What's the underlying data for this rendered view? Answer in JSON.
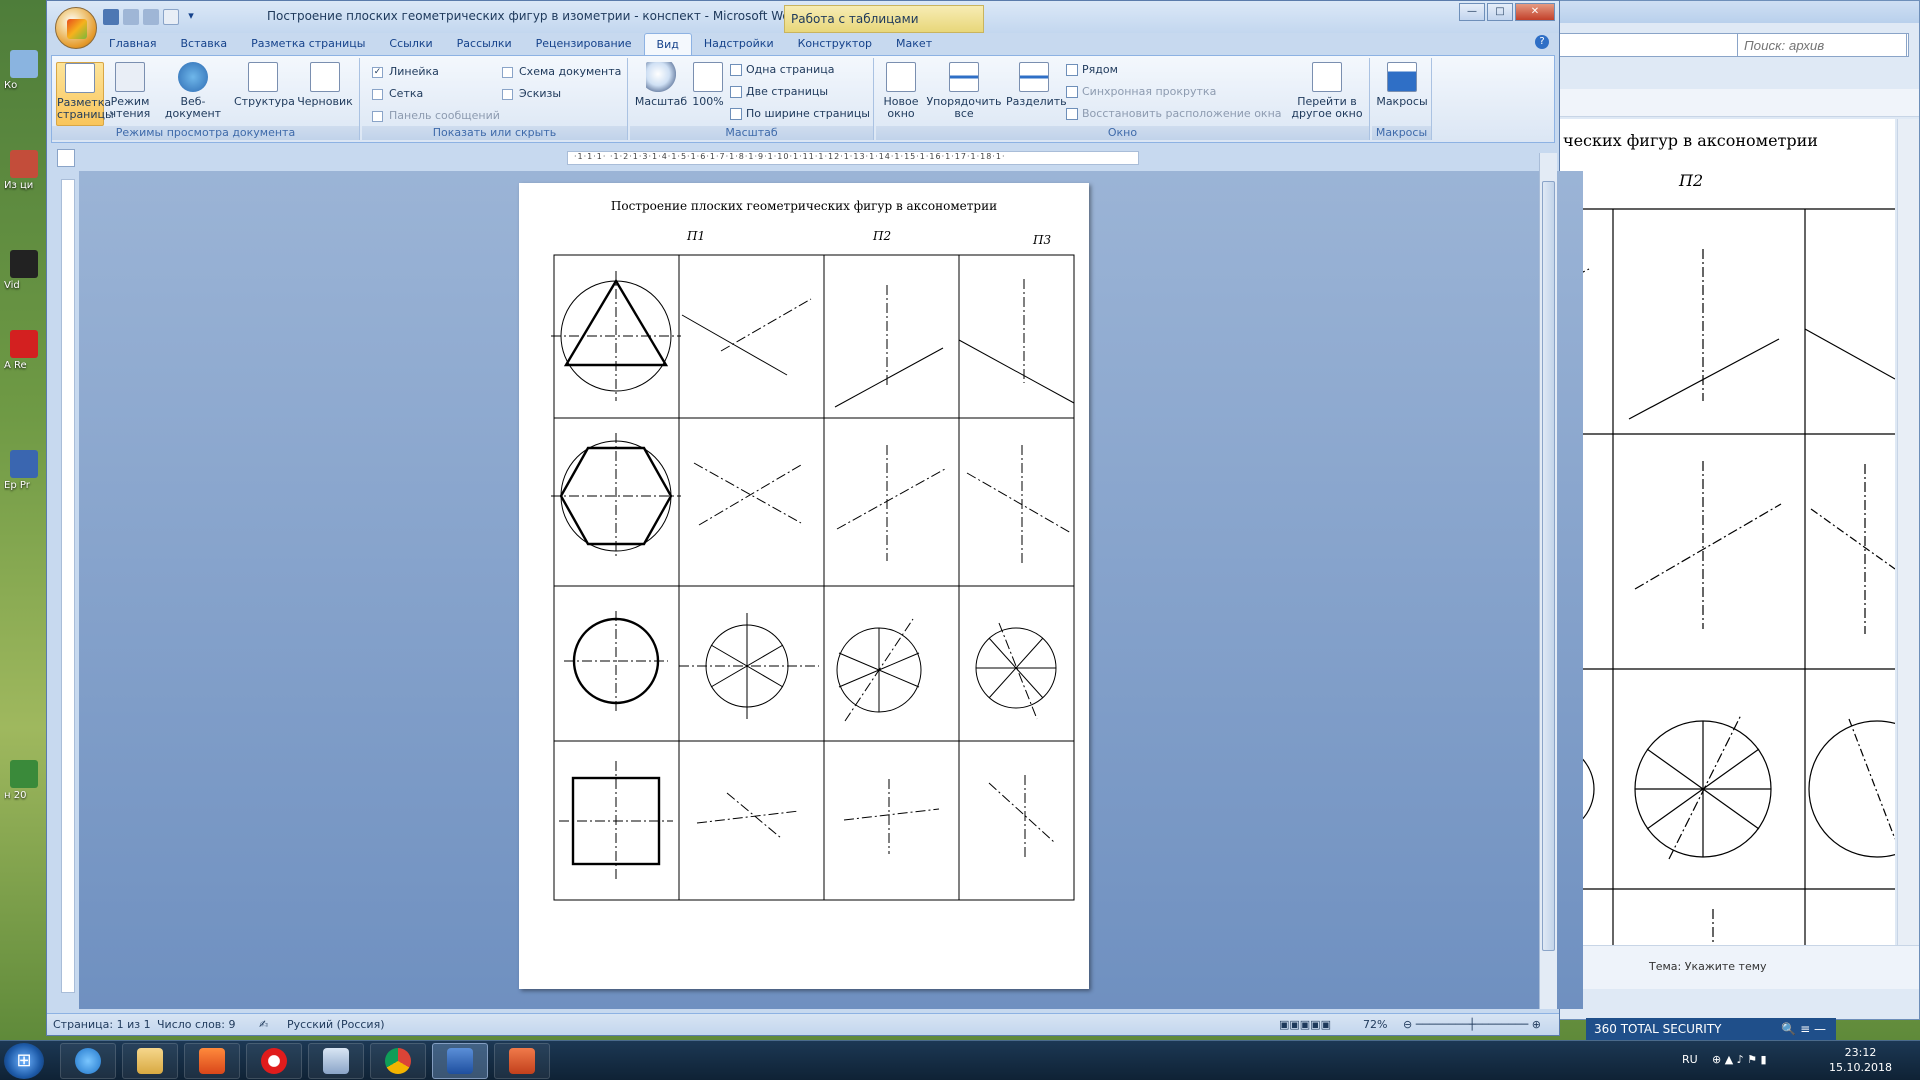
{
  "word": {
    "title": "Построение плоских геометрических фигур в изометрии - конспект - Microsoft Word",
    "context_tab": "Работа с таблицами",
    "tabs": [
      "Главная",
      "Вставка",
      "Разметка страницы",
      "Ссылки",
      "Рассылки",
      "Рецензирование",
      "Вид",
      "Надстройки",
      "Конструктор",
      "Макет"
    ],
    "active_tab": "Вид",
    "ribbon": {
      "views": {
        "label": "Режимы просмотра документа",
        "buttons": [
          {
            "label": "Разметка страницы",
            "selected": true
          },
          {
            "label": "Режим чтения"
          },
          {
            "label": "Веб-документ"
          },
          {
            "label": "Структура"
          },
          {
            "label": "Черновик"
          }
        ]
      },
      "show_hide": {
        "label": "Показать или скрыть",
        "items": [
          {
            "label": "Линейка",
            "checked": true
          },
          {
            "label": "Схема документа",
            "checked": false
          },
          {
            "label": "Сетка",
            "checked": false
          },
          {
            "label": "Эскизы",
            "checked": false
          },
          {
            "label": "Панель сообщений",
            "checked": false,
            "disabled": true
          }
        ]
      },
      "zoom": {
        "label": "Масштаб",
        "zoom_label": "Масштаб",
        "pct_label": "100%",
        "one_page": "Одна страница",
        "two_pages": "Две страницы",
        "page_width": "По ширине страницы"
      },
      "window": {
        "label": "Окно",
        "new_window": "Новое окно",
        "arrange_all": "Упорядочить все",
        "split": "Разделить",
        "side_by_side": "Рядом",
        "sync_scroll": "Синхронная прокрутка",
        "reset_pos": "Восстановить расположение окна",
        "switch_windows": "Перейти в другое окно"
      },
      "macros": {
        "label": "Макросы",
        "button": "Макросы"
      }
    },
    "ruler_text": "·1·1·1·  ·1·2·1·3·1·4·1·5·1·6·1·7·1·8·1·9·1·10·1·11·1·12·1·13·1·14·1·15·1·16·1·17·1·18·1·",
    "document": {
      "title": "Построение плоских геометрических фигур  в аксонометрии",
      "plane_labels": [
        "П1",
        "П2",
        "П3"
      ]
    },
    "status": {
      "page": "Страница: 1 из 1",
      "words": "Число слов: 9",
      "language": "Русский (Россия)",
      "zoom": "72%"
    }
  },
  "background_window": {
    "search_placeholder": "Поиск: архив",
    "doc_title": "ческих фигур в аксонометрии",
    "plane_label": "П2",
    "theme_label": "Тема:",
    "theme_value": "Укажите тему",
    "banner": "360 TOTAL SECURITY"
  },
  "desktop_icons": [
    "Ко",
    "Из ци",
    "Vid",
    "А Re",
    "Ep Pr",
    "н 20"
  ],
  "taskbar": {
    "apps": [
      "internet-explorer",
      "file-explorer",
      "media-player",
      "opera",
      "calculator",
      "chrome",
      "word",
      "presentation"
    ],
    "language": "RU",
    "time": "23:12",
    "date": "15.10.2018"
  }
}
